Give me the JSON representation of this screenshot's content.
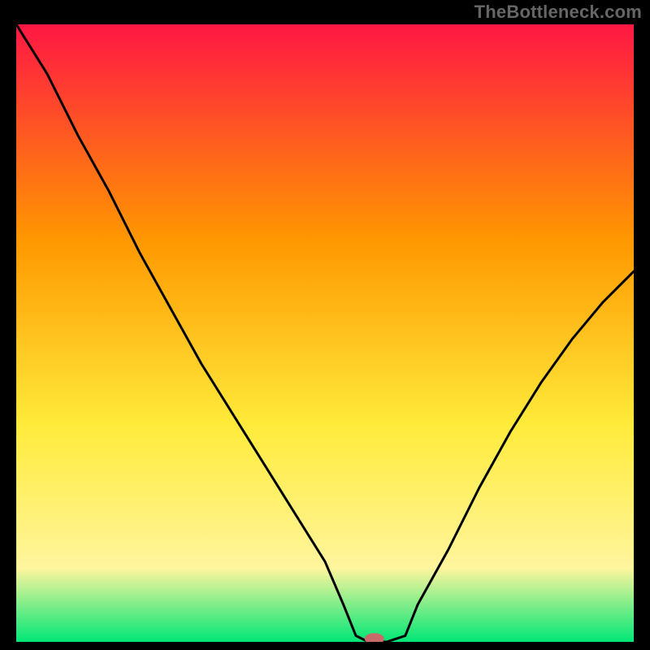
{
  "watermark": "TheBottleneck.com",
  "chart_data": {
    "type": "line",
    "title": "",
    "xlabel": "",
    "ylabel": "",
    "xlim": [
      0,
      100
    ],
    "ylim": [
      0,
      100
    ],
    "grid": false,
    "legend": false,
    "background_gradient": {
      "top": "#ff1744",
      "mid1": "#ff9800",
      "mid2": "#ffeb3b",
      "mid3": "#fff59d",
      "bottom": "#00e676"
    },
    "series": [
      {
        "name": "bottleneck-curve",
        "color": "#000000",
        "x": [
          0,
          5,
          10,
          15,
          20,
          25,
          30,
          35,
          40,
          45,
          50,
          53,
          55,
          57,
          60,
          63,
          65,
          70,
          75,
          80,
          85,
          90,
          95,
          100
        ],
        "y": [
          100,
          92,
          82,
          73,
          63,
          54,
          45,
          37,
          29,
          21,
          13,
          6,
          1,
          0,
          0,
          1,
          6,
          15,
          25,
          34,
          42,
          49,
          55,
          60
        ]
      }
    ],
    "marker": {
      "name": "optimal-point",
      "x": 58,
      "y": 0.5,
      "color": "#c96a6a",
      "rx": 12,
      "ry": 7
    }
  }
}
